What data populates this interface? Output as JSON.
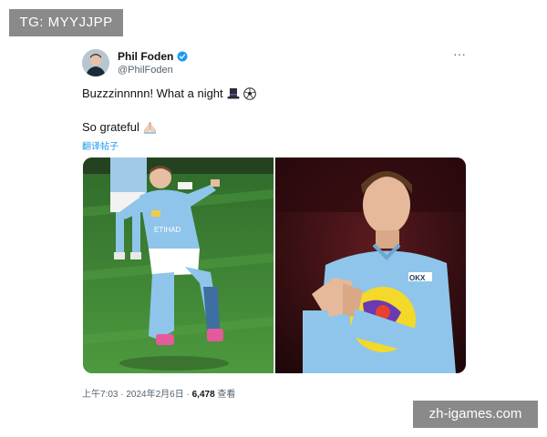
{
  "watermarks": {
    "top_left": "TG: MYYJJPP",
    "bottom_right": "zh-igames.com"
  },
  "tweet": {
    "display_name": "Phil Foden",
    "handle": "@PhilFoden",
    "text_line1": "Buzzzinnnnn! What a night",
    "text_line2": "So grateful",
    "emoji": {
      "line1": [
        "top-hat-icon",
        "soccer-ball-icon"
      ],
      "line2": [
        "praying-hands-icon"
      ]
    },
    "translate_label": "翻译帖子",
    "timestamp": "上午7:03 · 2024年2月6日 · ",
    "view_count": "6,478",
    "views_label": " 查看",
    "more_label": "···"
  },
  "colors": {
    "accent": "#1d9bf0",
    "kit_blue": "#8fc5ea",
    "pitch_green": "#3f8a34",
    "dark_bg": "#3a0d12"
  }
}
